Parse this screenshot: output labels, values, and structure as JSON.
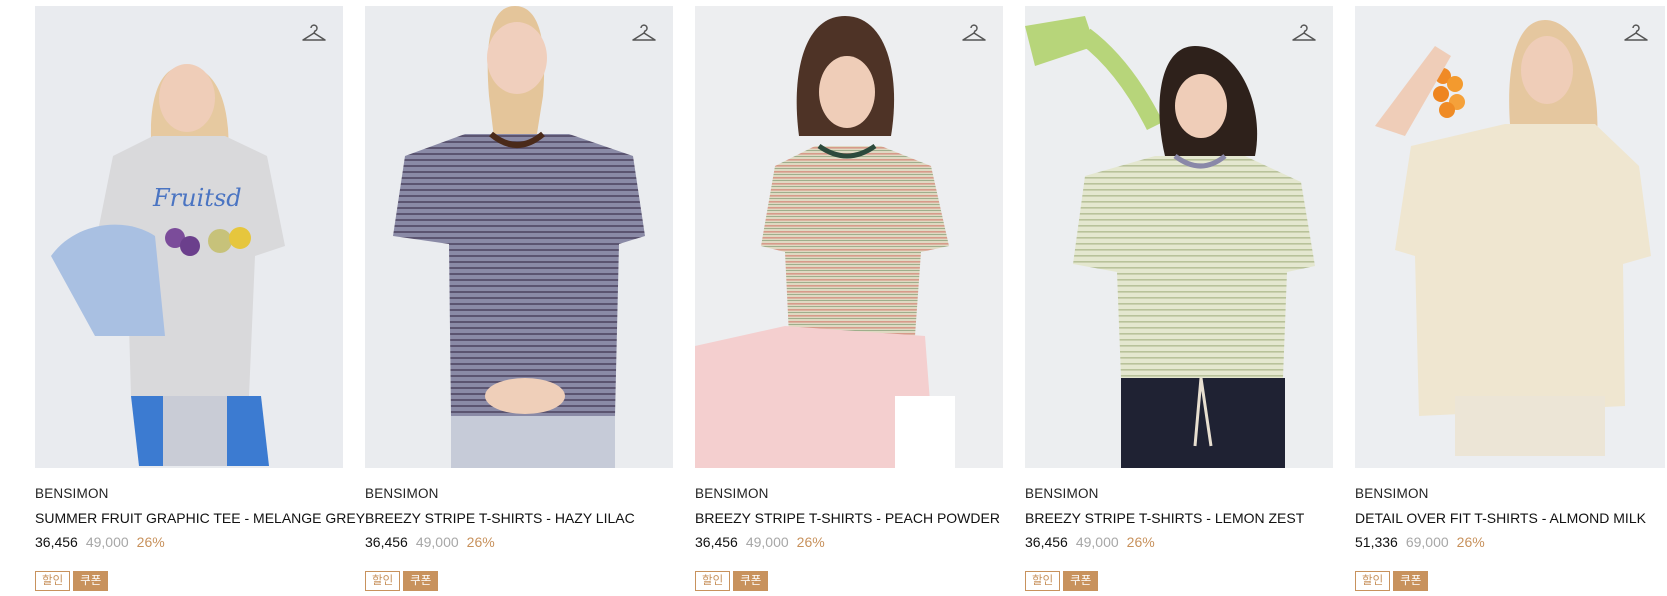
{
  "colors": {
    "accent": "#c8925d",
    "original_price": "#a7a7a7",
    "photo_bg": "#eceef2"
  },
  "products": [
    {
      "brand": "BENSIMON",
      "name": "SUMMER FRUIT GRAPHIC TEE - MELANGE GREY",
      "price": "36,456",
      "original_price": "49,000",
      "discount": "26%",
      "badges": [
        "할인",
        "쿠폰"
      ],
      "icon": "hanger-icon"
    },
    {
      "brand": "BENSIMON",
      "name": "BREEZY STRIPE T-SHIRTS - HAZY LILAC",
      "price": "36,456",
      "original_price": "49,000",
      "discount": "26%",
      "badges": [
        "할인",
        "쿠폰"
      ],
      "icon": "hanger-icon"
    },
    {
      "brand": "BENSIMON",
      "name": "BREEZY STRIPE T-SHIRTS - PEACH POWDER",
      "price": "36,456",
      "original_price": "49,000",
      "discount": "26%",
      "badges": [
        "할인",
        "쿠폰"
      ],
      "icon": "hanger-icon"
    },
    {
      "brand": "BENSIMON",
      "name": "BREEZY STRIPE T-SHIRTS - LEMON ZEST",
      "price": "36,456",
      "original_price": "49,000",
      "discount": "26%",
      "badges": [
        "할인",
        "쿠폰"
      ],
      "icon": "hanger-icon"
    },
    {
      "brand": "BENSIMON",
      "name": "DETAIL OVER FIT T-SHIRTS - ALMOND MILK",
      "price": "51,336",
      "original_price": "69,000",
      "discount": "26%",
      "badges": [
        "할인",
        "쿠폰"
      ],
      "icon": "hanger-icon"
    }
  ]
}
